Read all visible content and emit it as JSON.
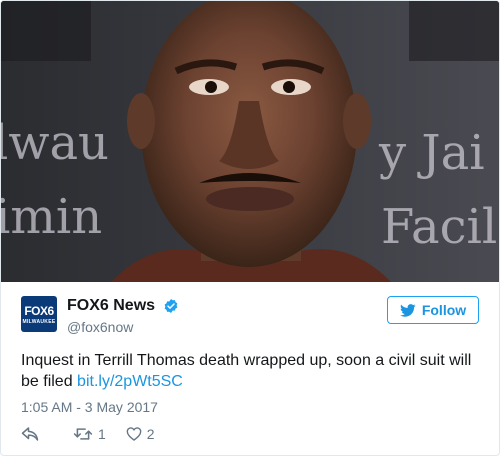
{
  "media": {
    "background_text": {
      "left_top": "lwau",
      "left_bottom": "imin",
      "right_top": "y Jai",
      "right_bottom": "Facil"
    }
  },
  "author": {
    "display_name": "FOX6 News",
    "handle": "@fox6now",
    "verified": true,
    "avatar_brand": "FOX6",
    "avatar_sub": "MILWAUKEE"
  },
  "follow_button": {
    "label": "Follow",
    "icon": "twitter-bird-icon"
  },
  "tweet": {
    "text": "Inquest in Terrill Thomas death wrapped up, soon a civil suit will be filed ",
    "link": "bit.ly/2pWt5SC",
    "timestamp": "1:05 AM - 3 May 2017"
  },
  "actions": {
    "reply_icon": "reply-icon",
    "retweet_icon": "retweet-icon",
    "retweet_count": "1",
    "like_icon": "heart-icon",
    "like_count": "2"
  },
  "colors": {
    "accent": "#1b95e0",
    "text": "#14171a",
    "muted": "#657786",
    "border": "#e1e8ed",
    "avatar_bg": "#0b3a78"
  }
}
